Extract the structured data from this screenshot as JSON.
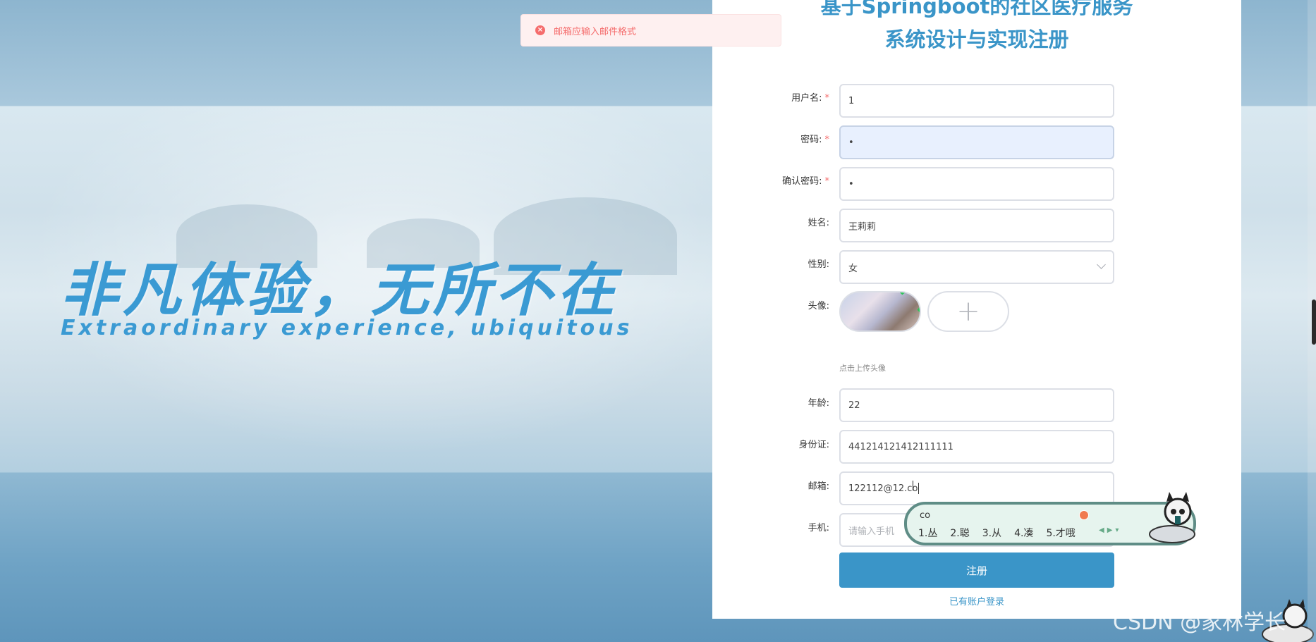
{
  "hero": {
    "title": "非凡体验，无所不在",
    "subtitle": "Extraordinary experience, ubiquitous"
  },
  "toast": {
    "message": "邮箱应输入邮件格式",
    "icon": "error-circle-icon",
    "color": "#f56c6c"
  },
  "form": {
    "title_line1": "基于Springboot的社区医疗服务",
    "title_line2": "系统设计与实现注册",
    "fields": {
      "username": {
        "label": "用户名:",
        "value": "1",
        "required_mark": "*"
      },
      "password": {
        "label": "密码:",
        "value": "•",
        "required_mark": "*"
      },
      "confirm_password": {
        "label": "确认密码:",
        "value": "•",
        "required_mark": "*"
      },
      "name": {
        "label": "姓名:",
        "value": "王莉莉"
      },
      "gender": {
        "label": "性别:",
        "value": "女"
      },
      "avatar": {
        "label": "头像:",
        "upload_hint": "点击上传头像",
        "add_icon": "+"
      },
      "age": {
        "label": "年龄:",
        "value": "22"
      },
      "id_card": {
        "label": "身份证:",
        "value": "441214121412111111"
      },
      "email": {
        "label": "邮箱:",
        "value": "122112@12.co"
      },
      "phone": {
        "label": "手机:",
        "placeholder": "请输入手机"
      }
    },
    "submit_label": "注册",
    "login_link": "已有账户登录"
  },
  "ime": {
    "input": "co",
    "candidates": [
      "1.丛",
      "2.聪",
      "3.从",
      "4.凑",
      "5.才哦"
    ]
  },
  "watermark": "CSDN @家林学长",
  "colors": {
    "accent": "#3a95c8",
    "error": "#f56c6c",
    "hero_text": "#3a9ad3"
  }
}
